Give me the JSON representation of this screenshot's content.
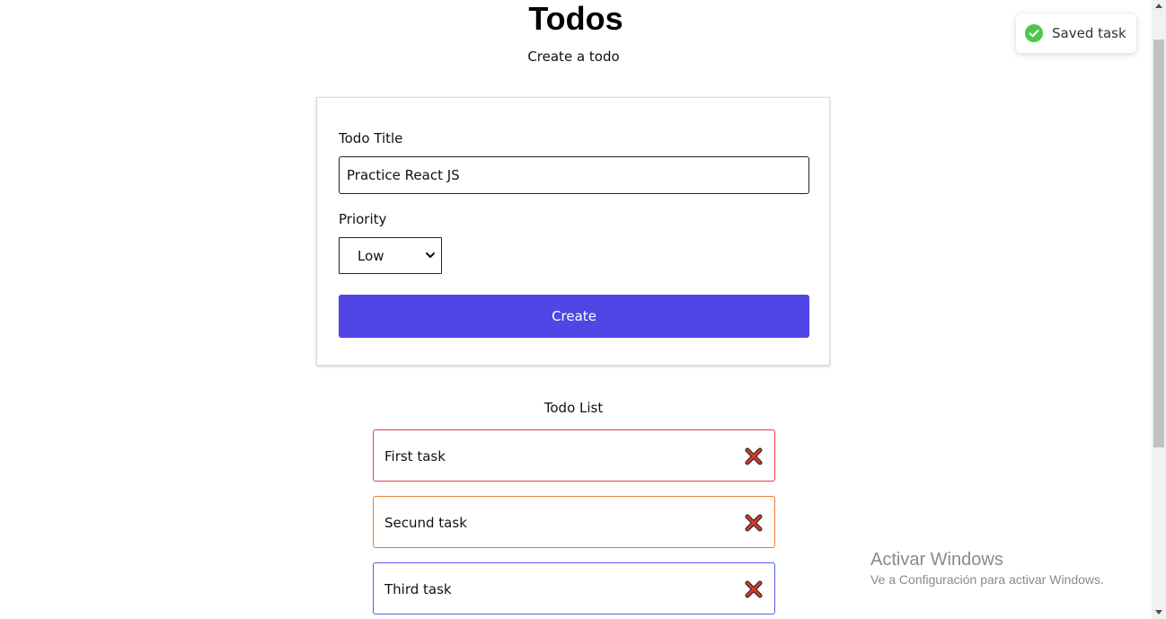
{
  "header": {
    "title": "Todos",
    "subtitle": "Create a todo"
  },
  "form": {
    "title_label": "Todo Title",
    "title_value": "Practice React JS",
    "priority_label": "Priority",
    "priority_value": "Low",
    "create_label": "Create",
    "create_color": "#4f46e5"
  },
  "list": {
    "heading": "Todo List",
    "items": [
      {
        "text": "First task",
        "border_color": "#e53e3e",
        "icon": "delete-x-icon"
      },
      {
        "text": "Secund task",
        "border_color": "#ed7d31",
        "icon": "delete-x-icon"
      },
      {
        "text": "Third task",
        "border_color": "#5b5fe6",
        "icon": "delete-x-icon"
      }
    ]
  },
  "toast": {
    "message": "Saved task",
    "icon": "check-circle-icon",
    "icon_color": "#4cc64c"
  },
  "watermark": {
    "title": "Activar Windows",
    "subtitle": "Ve a Configuración para activar Windows."
  }
}
